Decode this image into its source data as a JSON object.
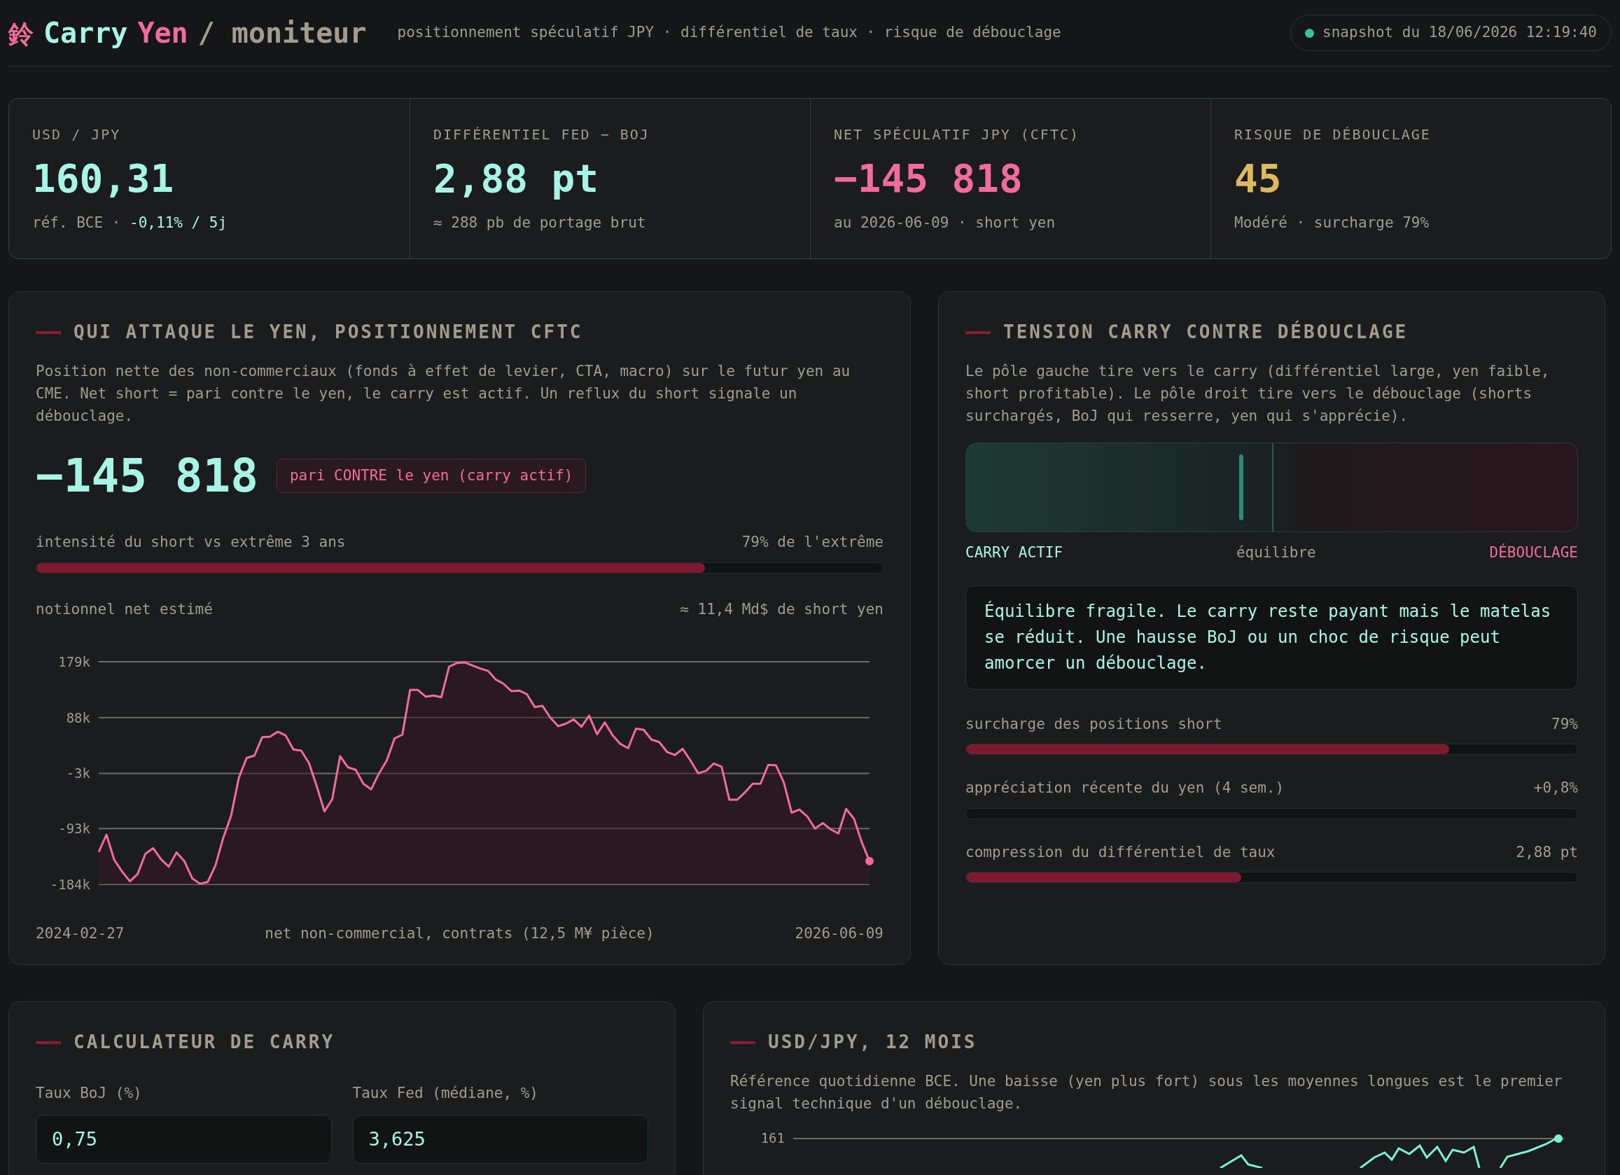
{
  "header": {
    "logo": "鈴",
    "title": [
      {
        "text": "Carry",
        "color": "#a8f5e6"
      },
      {
        "text": "Yen",
        "color": "#f06c9b"
      },
      {
        "text": "/ moniteur",
        "color": "#a39b8c"
      }
    ],
    "subtitle": "positionnement spéculatif JPY · différentiel de taux · risque de débouclage",
    "snapshot": {
      "text": "snapshot du 18/06/2026 12:19:40",
      "live": true
    }
  },
  "kpis": [
    {
      "label": "USD / JPY",
      "value": "160,31",
      "color": "#a8f5e6",
      "sub": [
        {
          "text": "réf. BCE · "
        },
        {
          "text": "-0,11% / 5j",
          "color": "#a8f5e6"
        }
      ]
    },
    {
      "label": "DIFFÉRENTIEL FED − BOJ",
      "value": "2,88 pt",
      "color": "#a8f5e6",
      "sub": [
        {
          "text": "≈ 288 pb de portage brut"
        }
      ]
    },
    {
      "label": "NET SPÉCULATIF JPY (CFTC)",
      "value": "−145 818",
      "color": "#f06c9b",
      "sub": [
        {
          "text": "au 2026-06-09 · short yen"
        }
      ]
    },
    {
      "label": "RISQUE DE DÉBOUCLAGE",
      "value": "45",
      "color": "#dcb860",
      "sub": [
        {
          "text": "Modéré · surcharge 79%"
        }
      ]
    }
  ],
  "positioning": {
    "title": "QUI ATTAQUE LE YEN, POSITIONNEMENT CFTC",
    "description": "Position nette des non-commerciaux (fonds à effet de levier, CTA, macro) sur le futur yen au CME. Net short = pari contre le yen, le carry est actif. Un reflux du short signale un débouclage.",
    "net": "−145 818",
    "badge": "pari CONTRE le yen (carry actif)",
    "intensity": {
      "label": "intensité du short vs extrême 3 ans",
      "reading": "79% de l'extrême",
      "level": 0.79
    },
    "notional": {
      "label": "notionnel net estimé",
      "reading": "≈ 11,4 Md$ de short yen"
    },
    "chart_data": {
      "type": "line",
      "xlabel": "net non-commercial, contrats (12,5 M¥ pièce)",
      "ylim": [
        -184,
        179
      ],
      "grid": true,
      "yticks": [
        {
          "value": 179,
          "label": "179k"
        },
        {
          "value": 88,
          "label": "88k"
        },
        {
          "value": -3,
          "label": "-3k"
        },
        {
          "value": -93,
          "label": "-93k"
        },
        {
          "value": -184,
          "label": "-184k"
        }
      ],
      "series": [
        {
          "color": "#f06c9b",
          "values": [
            -131,
            -103,
            -144,
            -163,
            -179,
            -167,
            -134,
            -125,
            -143,
            -155,
            -132,
            -146,
            -174,
            -183,
            -180,
            -153,
            -108,
            -72,
            -10,
            22,
            26,
            56,
            57,
            65,
            59,
            36,
            34,
            14,
            -24,
            -65,
            -45,
            25,
            7,
            3,
            -20,
            -29,
            -3,
            18,
            54,
            60,
            133,
            133,
            122,
            124,
            121,
            171,
            177,
            178,
            173,
            168,
            164,
            150,
            143,
            131,
            132,
            126,
            105,
            107,
            88,
            74,
            78,
            85,
            73,
            91,
            61,
            80,
            59,
            45,
            38,
            70,
            68,
            52,
            48,
            32,
            27,
            37,
            18,
            -3,
            1,
            13,
            8,
            -46,
            -46,
            -34,
            -20,
            -20,
            11,
            10,
            -18,
            -67,
            -62,
            -73,
            -93,
            -84,
            -94,
            -101,
            -61,
            -77,
            -115,
            -146
          ]
        }
      ]
    },
    "date_range": {
      "start": "2024-02-27",
      "end": "2026-06-09"
    }
  },
  "tension": {
    "title": "TENSION CARRY CONTRE DÉBOUCLAGE",
    "description": "Le pôle gauche tire vers le carry (différentiel large, yen faible, short profitable). Le pôle droit tire vers le débouclage (shorts surchargés, BoJ qui resserre, yen qui s'apprécie).",
    "gauge": {
      "level": 0.45
    },
    "poles": {
      "left": "CARRY ACTIF",
      "center": "équilibre",
      "right": "DÉBOUCLAGE"
    },
    "note": "Équilibre fragile. Le carry reste payant mais le matelas se réduit. Une hausse BoJ ou un choc de risque peut amorcer un débouclage.",
    "meters": [
      {
        "label": "surcharge des positions short",
        "reading": "79%",
        "level": 0.79
      },
      {
        "label": "appréciation récente du yen (4 sem.)",
        "reading": "+0,8%"
      },
      {
        "label": "compression du différentiel de taux",
        "reading": "2,88 pt",
        "level": 0.45
      }
    ]
  },
  "calculator": {
    "title": "CALCULATEUR DE CARRY",
    "fields": [
      {
        "label": "Taux BoJ (%)",
        "value": "0,75"
      },
      {
        "label": "Taux Fed (médiane, %)",
        "value": "3,625"
      }
    ]
  },
  "usdjpy": {
    "title": "USD/JPY, 12 MOIS",
    "description": "Référence quotidienne BCE. Une baisse (yen plus fort) sous les moyennes longues est le premier signal technique d'un débouclage.",
    "tick": "161"
  }
}
